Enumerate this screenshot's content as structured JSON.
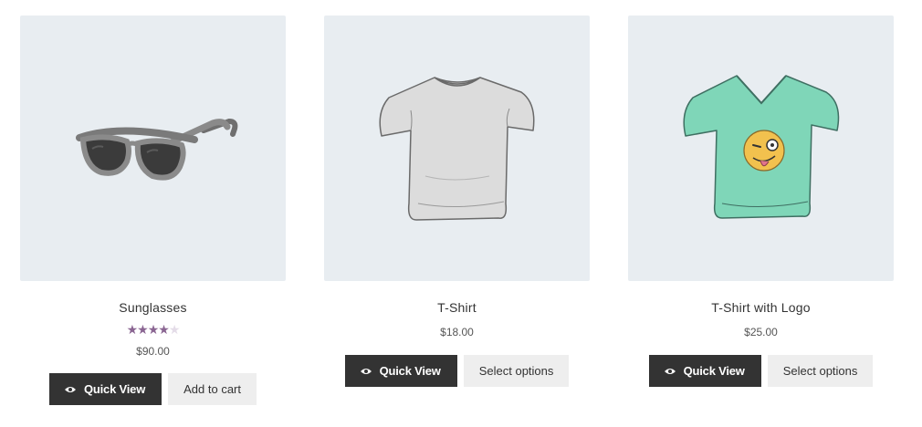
{
  "products": [
    {
      "name": "Sunglasses",
      "price": "$90.00",
      "rating": 4,
      "rating_max": 5,
      "image_icon": "sunglasses-image",
      "quick_view_label": "Quick View",
      "secondary_label": "Add to cart"
    },
    {
      "name": "T-Shirt",
      "price": "$18.00",
      "image_icon": "tshirt-image",
      "quick_view_label": "Quick View",
      "secondary_label": "Select options"
    },
    {
      "name": "T-Shirt with Logo",
      "price": "$25.00",
      "image_icon": "tshirt-logo-image",
      "quick_view_label": "Quick View",
      "secondary_label": "Select options"
    }
  ],
  "colors": {
    "image_background": "#e8edf1",
    "button_dark": "#333333",
    "button_light": "#eeeeee",
    "star_full": "#8a6592",
    "star_empty": "#e4dce8",
    "tshirt_logo_color": "#7fd6b8"
  }
}
